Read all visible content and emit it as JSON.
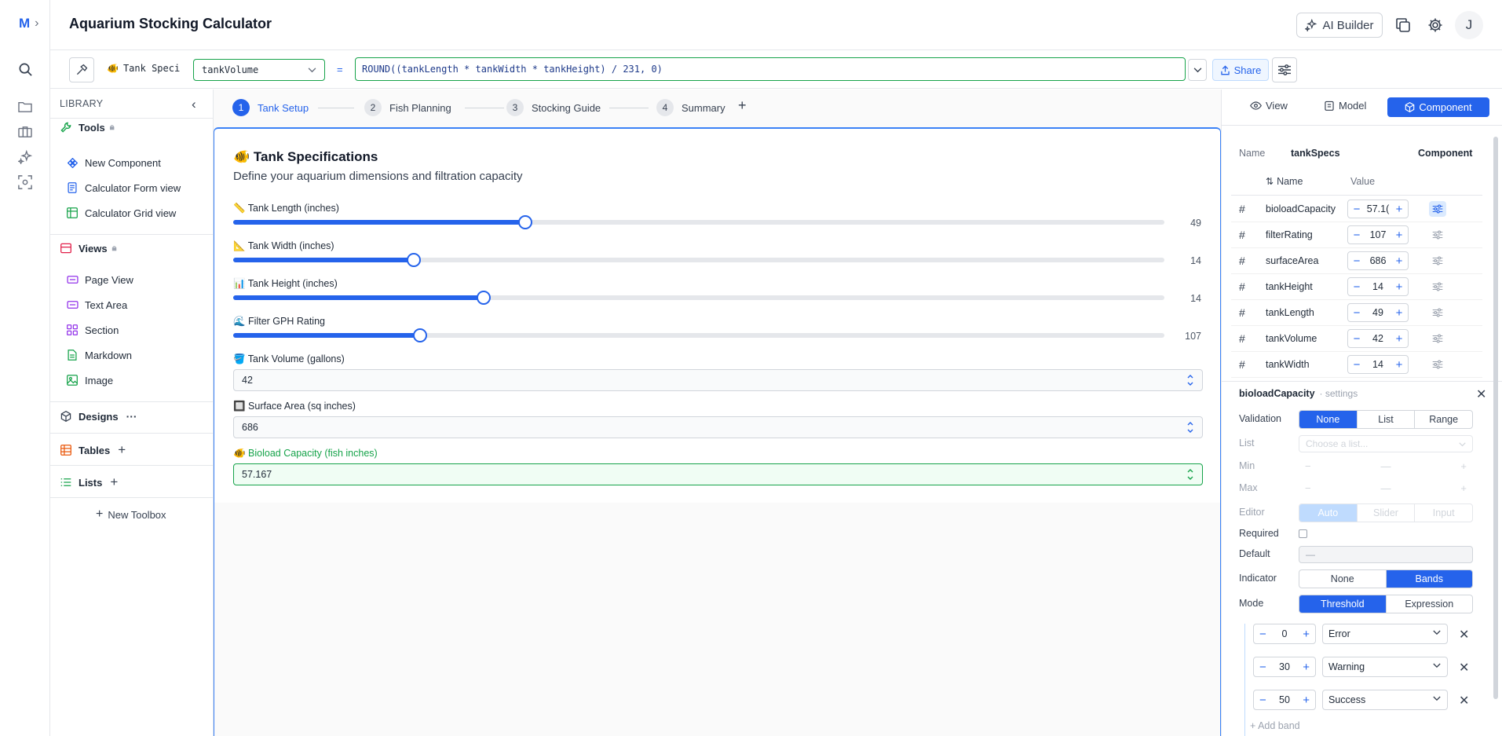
{
  "header": {
    "logo_letter": "M",
    "logo_chevron": "›",
    "title": "Aquarium Stocking Calculator",
    "ai_builder": "AI Builder",
    "avatar": "J"
  },
  "formula_bar": {
    "component_label": "Tank Speci",
    "field": "tankVolume",
    "equals": "=",
    "expression": "ROUND((tankLength * tankWidth * tankHeight) / 231, 0)",
    "share": "Share"
  },
  "library": {
    "title": "LIBRARY",
    "tools_label": "Tools",
    "tools": [
      "New Component",
      "Calculator Form view",
      "Calculator Grid view"
    ],
    "views_label": "Views",
    "views": [
      "Page View",
      "Text Area",
      "Section",
      "Markdown",
      "Image"
    ],
    "designs_label": "Designs",
    "designs_more": "···",
    "tables_label": "Tables",
    "lists_label": "Lists",
    "new_toolbox": "New Toolbox",
    "plus": "+"
  },
  "steps": [
    {
      "num": "1",
      "label": "Tank Setup"
    },
    {
      "num": "2",
      "label": "Fish Planning"
    },
    {
      "num": "3",
      "label": "Stocking Guide"
    },
    {
      "num": "4",
      "label": "Summary"
    }
  ],
  "steps_add": "+",
  "card": {
    "title": "🐠 Tank Specifications",
    "subtitle": "Define your aquarium dimensions and filtration capacity",
    "sliders": [
      {
        "label": "📏 Tank Length (inches)",
        "value": "49",
        "fraction": 0.314
      },
      {
        "label": "📐 Tank Width (inches)",
        "value": "14",
        "fraction": 0.194
      },
      {
        "label": "📊 Tank Height (inches)",
        "value": "14",
        "fraction": 0.269
      },
      {
        "label": "🌊 Filter GPH Rating",
        "value": "107",
        "fraction": 0.201
      }
    ],
    "fields": [
      {
        "label": "🪣 Tank Volume (gallons)",
        "value": "42"
      },
      {
        "label": "🔲 Surface Area (sq inches)",
        "value": "686"
      },
      {
        "label": "🐠 Bioload Capacity (fish inches)",
        "value": "57.167"
      }
    ]
  },
  "rpanel": {
    "tabs": [
      "View",
      "Model",
      "Component"
    ],
    "name_label": "Name",
    "name_value": "tankSpecs",
    "type_label": "Component",
    "col_name": "Name",
    "col_value": "Value",
    "props": [
      {
        "name": "bioloadCapacity",
        "value": "57.1("
      },
      {
        "name": "filterRating",
        "value": "107"
      },
      {
        "name": "surfaceArea",
        "value": "686"
      },
      {
        "name": "tankHeight",
        "value": "14"
      },
      {
        "name": "tankLength",
        "value": "49"
      },
      {
        "name": "tankVolume",
        "value": "42"
      },
      {
        "name": "tankWidth",
        "value": "14"
      }
    ],
    "settings_name": "bioloadCapacity",
    "settings_suffix": "· settings",
    "validation_label": "Validation",
    "validation_opts": [
      "None",
      "List",
      "Range"
    ],
    "list_label": "List",
    "list_placeholder": "Choose a list...",
    "min_label": "Min",
    "max_label": "Max",
    "minus": "—",
    "editor_label": "Editor",
    "editor_opts": [
      "Auto",
      "Slider",
      "Input"
    ],
    "required_label": "Required",
    "default_label": "Default",
    "default_value": "—",
    "indicator_label": "Indicator",
    "indicator_opts": [
      "None",
      "Bands"
    ],
    "mode_label": "Mode",
    "mode_opts": [
      "Threshold",
      "Expression"
    ],
    "bands": [
      {
        "value": "0",
        "status": "Error"
      },
      {
        "value": "30",
        "status": "Warning"
      },
      {
        "value": "50",
        "status": "Success"
      }
    ],
    "add_band": "+ Add band"
  }
}
